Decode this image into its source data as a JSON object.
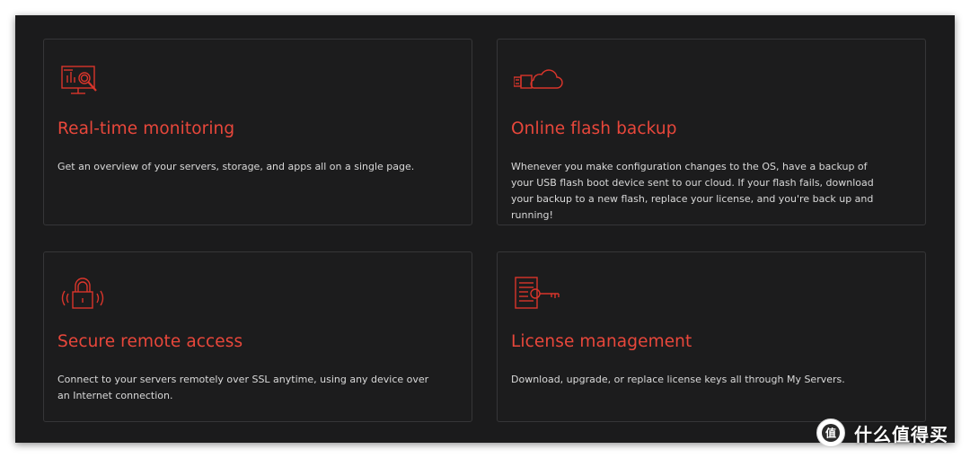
{
  "cards": [
    {
      "title": "Real-time monitoring",
      "description": "Get an overview of your servers, storage, and apps all on a single page.",
      "icon": "monitor-chart-icon"
    },
    {
      "title": "Online flash backup",
      "description": "Whenever you make configuration changes to the OS, have a backup of your USB flash boot device sent to our cloud. If your flash fails, download your backup to a new flash, replace your license, and you're back up and running!",
      "icon": "usb-cloud-icon"
    },
    {
      "title": "Secure remote access",
      "description": "Connect to your servers remotely over SSL anytime, using any device over an Internet connection.",
      "icon": "padlock-signal-icon"
    },
    {
      "title": "License management",
      "description": "Download, upgrade, or replace license keys all through My Servers.",
      "icon": "document-key-icon"
    }
  ],
  "watermark": {
    "text": "什么值得买",
    "logo_icon": "smzdm-logo-icon"
  },
  "colors": {
    "accent": "#e8473b",
    "background": "#1b1b1c",
    "card_border": "#363638",
    "body_text": "#d9d9d9"
  }
}
